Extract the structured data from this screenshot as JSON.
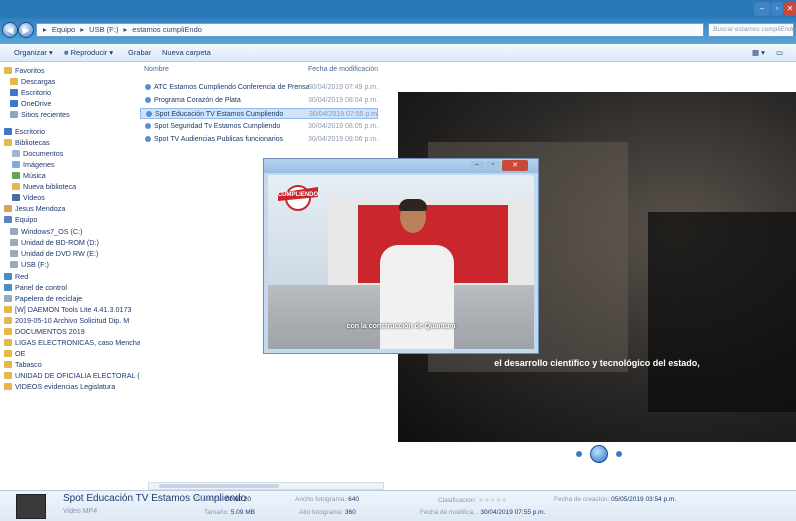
{
  "window": {
    "breadcrumb": [
      "Equipo",
      "USB (F:)",
      "estamos cumpliEndo"
    ],
    "search_placeholder": "Buscar estamos cumpliEndo"
  },
  "toolbar": {
    "organize": "Organizar ▾",
    "play": "Reproducir ▾",
    "burn": "Grabar",
    "new_folder": "Nueva carpeta"
  },
  "nav": {
    "items": [
      {
        "label": "Favoritos",
        "color": "#e6b84a"
      },
      {
        "label": "Descargas",
        "color": "#e6b84a"
      },
      {
        "label": "Escritorio",
        "color": "#3a78c8"
      },
      {
        "label": "OneDrive",
        "color": "#3a78c8"
      },
      {
        "label": "Sitios recientes",
        "color": "#8fa6c2"
      },
      {
        "label": "Escritorio",
        "color": "#3a78c8"
      },
      {
        "label": "Bibliotecas",
        "color": "#e6b84a"
      },
      {
        "label": "Documentos",
        "color": "#9fb6d3"
      },
      {
        "label": "Imágenes",
        "color": "#7ab0d8"
      },
      {
        "label": "Música",
        "color": "#6aa15a"
      },
      {
        "label": "Nueva biblioteca",
        "color": "#e6b84a"
      },
      {
        "label": "Videos",
        "color": "#4a6da6"
      },
      {
        "label": "Jesus Mendoza",
        "color": "#d8a25a"
      },
      {
        "label": "Equipo",
        "color": "#5f85b8"
      },
      {
        "label": "Windows7_OS (C:)",
        "color": "#9aa9bc"
      },
      {
        "label": "Unidad de BD-ROM (D:)",
        "color": "#9aa9bc"
      },
      {
        "label": "Unidad de DVD RW (E:)",
        "color": "#9aa9bc"
      },
      {
        "label": "USB (F:)",
        "color": "#9aa9bc"
      },
      {
        "label": "Red",
        "color": "#4a8cc8"
      },
      {
        "label": "Panel de control",
        "color": "#4a8cc8"
      },
      {
        "label": "Papelera de reciclaje",
        "color": "#9aa9bc"
      },
      {
        "label": "[W] DAEMON Tools Lite 4.41.3.0173",
        "color": "#e6b84a"
      },
      {
        "label": "2019-05-10 Archivo Solicitud Dip. M",
        "color": "#e6b84a"
      },
      {
        "label": "DOCUMENTOS 2019",
        "color": "#e6b84a"
      },
      {
        "label": "LIGAS ELECTRONICAS, caso Mencha",
        "color": "#e6b84a"
      },
      {
        "label": "OE",
        "color": "#e6b84a"
      },
      {
        "label": "Tabasco",
        "color": "#e6b84a"
      },
      {
        "label": "UNIDAD DE OFICIALIA ELECTORAL (",
        "color": "#e6b84a"
      },
      {
        "label": "VIDEOS evidencias Legislatura",
        "color": "#e6b84a"
      }
    ]
  },
  "files": {
    "col_name": "Nombre",
    "col_date": "Fecha de modificación",
    "rows": [
      {
        "name": "ATC Estamos Cumpliendo Conferencia de Prensa",
        "date": "30/04/2019 07:49 p.m."
      },
      {
        "name": "Programa Corazón de Plata",
        "date": "30/04/2019 08:04 p.m."
      },
      {
        "name": "Spot Educación TV Estamos Cumpliendo",
        "date": "30/04/2019 07:55 p.m."
      },
      {
        "name": "Spot Seguridad Tv Estamos Cumpliendo",
        "date": "30/04/2019 08:05 p.m."
      },
      {
        "name": "Spot TV Audiencias Publicas funcionarios",
        "date": "30/04/2019 08:06 p.m."
      }
    ]
  },
  "preview": {
    "subtitle_big": "el desarrollo científico y tecnológico del estado,",
    "subtitle_small": "con la construcción de Quantum",
    "logo_text": "CUMPLIENDO"
  },
  "details": {
    "title": "Spot Educación TV Estamos Cumpliendo",
    "type": "Video MP4",
    "duration_label": "Duración:",
    "duration": "00:00:20",
    "size_label": "Tamaño:",
    "size": "5.09 MB",
    "width_label": "Ancho fotograma:",
    "width": "640",
    "height_label": "Alto fotograma:",
    "height": "360",
    "rating_label": "Clasificación:",
    "modified_label": "Fecha de modifica...",
    "modified": "30/04/2019 07:55 p.m.",
    "created_label": "Fecha de creación:",
    "created": "05/05/2019 03:54 p.m."
  }
}
